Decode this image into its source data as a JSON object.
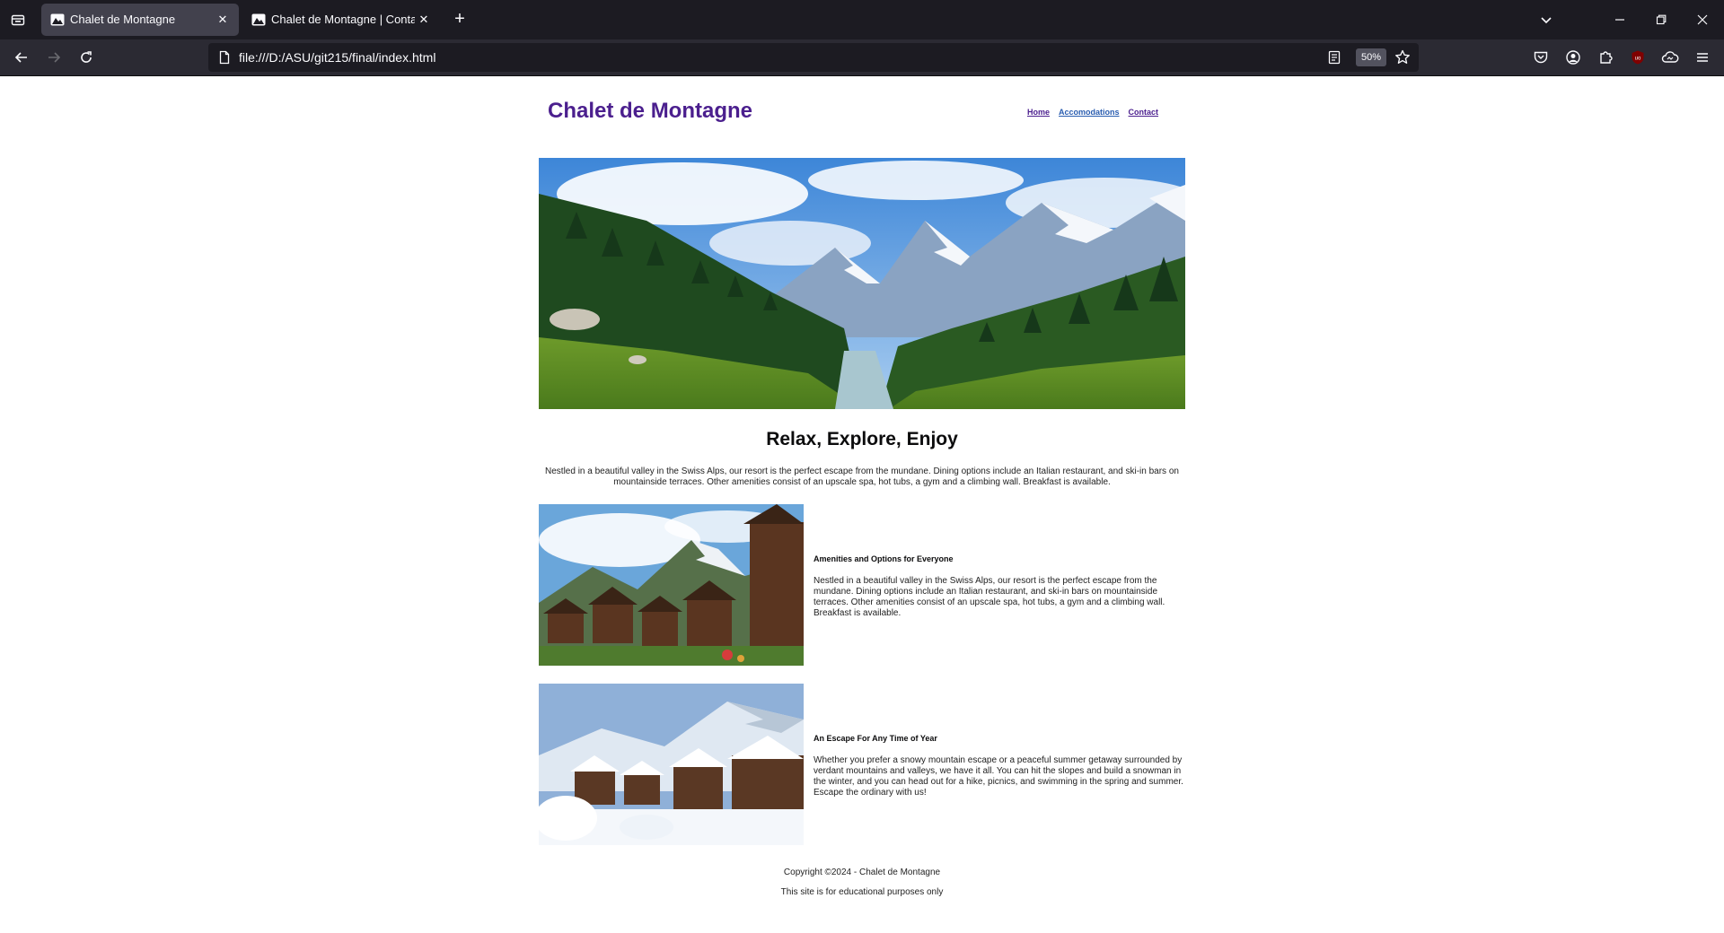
{
  "browser": {
    "tabs": [
      {
        "title": "Chalet de Montagne",
        "active": true
      },
      {
        "title": "Chalet de Montagne | Contact",
        "active": false
      }
    ],
    "url": "file:///D:/ASU/git215/final/index.html",
    "zoom": "50%",
    "ublock_badge": "uo"
  },
  "site": {
    "title": "Chalet de Montagne",
    "nav": [
      "Home",
      "Accomodations",
      "Contact"
    ],
    "headline": "Relax, Explore, Enjoy",
    "intro": "Nestled in a beautiful valley in the Swiss Alps, our resort is the perfect escape from the mundane. Dining options include an Italian restaurant, and ski-in bars on mountainside terraces. Other amenities consist of an upscale spa, hot tubs, a gym and a climbing wall. Breakfast is available.",
    "features": [
      {
        "heading": "Amenities and Options for Everyone",
        "body": "Nestled in a beautiful valley in the Swiss Alps, our resort is the perfect escape from the mundane. Dining options include an Italian restaurant, and ski-in bars on mountainside terraces. Other amenities consist of an upscale spa, hot tubs, a gym and a climbing wall. Breakfast is available."
      },
      {
        "heading": "An Escape For Any Time of Year",
        "body": "Whether you prefer a snowy mountain escape or a peaceful summer getaway surrounded by verdant mountains and valleys, we have it all. You can hit the slopes and build a snowman in the winter, and you can head out for a hike, picnics, and swimming in the spring and summer. Escape the ordinary with us!"
      }
    ],
    "footer": {
      "copyright": "Copyright ©2024 - Chalet de Montagne",
      "note": "This site is for educational purposes only"
    }
  },
  "colors": {
    "brand": "#4b1f8e",
    "chrome_dark": "#1c1b22",
    "chrome_toolbar": "#2b2a33"
  }
}
